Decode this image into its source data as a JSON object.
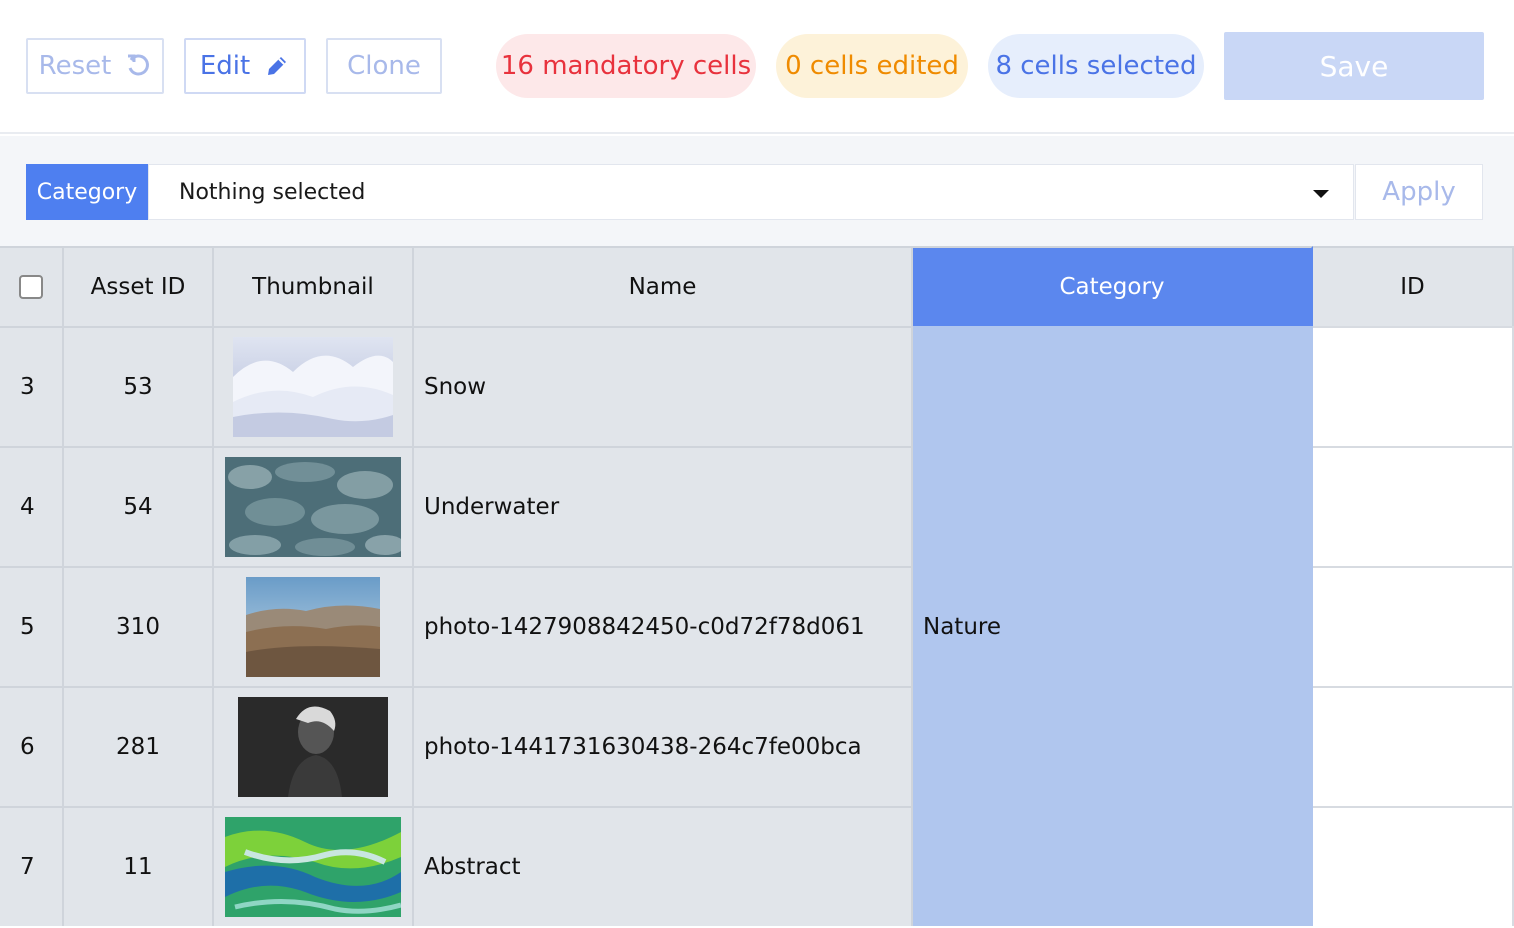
{
  "toolbar": {
    "reset_label": "Reset",
    "edit_label": "Edit",
    "clone_label": "Clone",
    "mandatory_badge": "16 mandatory cells",
    "edited_badge": "0 cells edited",
    "selected_badge": "8 cells selected",
    "save_label": "Save"
  },
  "filter": {
    "field_label": "Category",
    "selected_value": "Nothing selected",
    "apply_label": "Apply"
  },
  "table": {
    "columns": [
      "Asset ID",
      "Thumbnail",
      "Name",
      "Category",
      "ID"
    ],
    "rows": [
      {
        "row": "3",
        "asset_id": "53",
        "thumb": "snow",
        "name": "Snow",
        "category": "",
        "id": ""
      },
      {
        "row": "4",
        "asset_id": "54",
        "thumb": "underwater",
        "name": "Underwater",
        "category": "",
        "id": ""
      },
      {
        "row": "5",
        "asset_id": "310",
        "thumb": "desert",
        "name": "photo-1427908842450-c0d72f78d061",
        "category": "Nature",
        "id": ""
      },
      {
        "row": "6",
        "asset_id": "281",
        "thumb": "portrait",
        "name": "photo-1441731630438-264c7fe00bca",
        "category": "",
        "id": ""
      },
      {
        "row": "7",
        "asset_id": "11",
        "thumb": "abstract",
        "name": "Abstract",
        "category": "",
        "id": ""
      }
    ]
  },
  "colors": {
    "accent": "#4e7ff0",
    "selected_column": "#b0c6ee",
    "danger": "#e8323d",
    "warning": "#ef8b00"
  }
}
